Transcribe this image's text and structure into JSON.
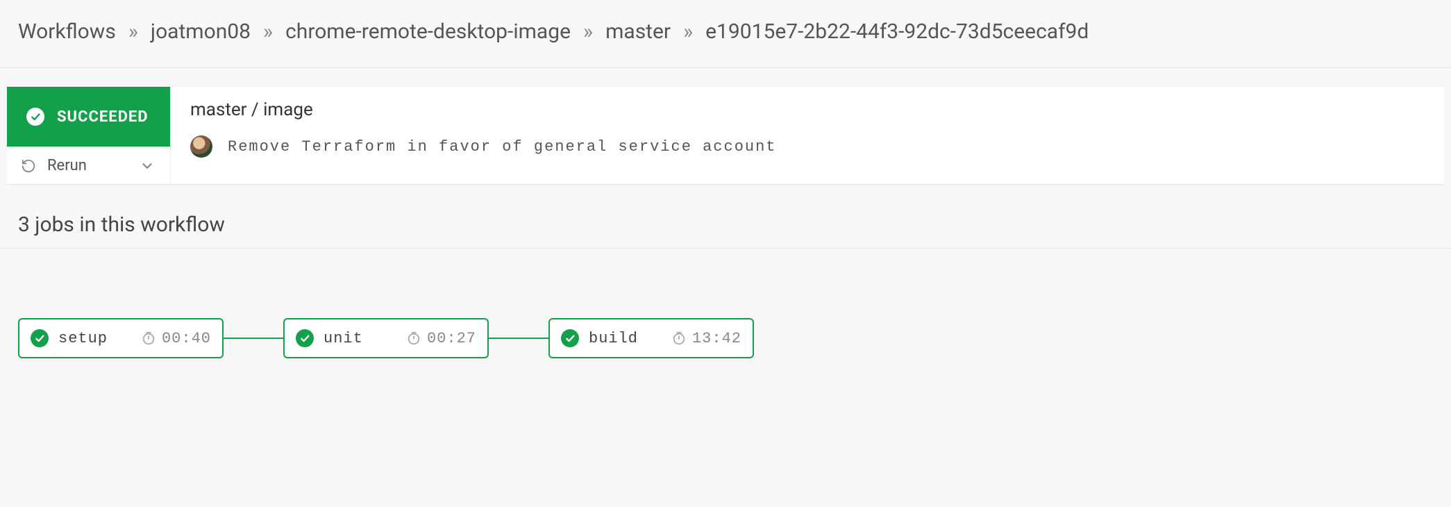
{
  "breadcrumb": {
    "items": [
      "Workflows",
      "joatmon08",
      "chrome-remote-desktop-image",
      "master",
      "e19015e7-2b22-44f3-92dc-73d5ceecaf9d"
    ],
    "separator": "»"
  },
  "status": {
    "label": "SUCCEEDED",
    "rerun_label": "Rerun"
  },
  "workflow": {
    "branch_workflow": "master / image",
    "commit_message": "Remove Terraform in favor of general service account"
  },
  "section": {
    "heading": "3 jobs in this workflow"
  },
  "jobs": [
    {
      "name": "setup",
      "duration": "00:40",
      "status": "success"
    },
    {
      "name": "unit",
      "duration": "00:27",
      "status": "success"
    },
    {
      "name": "build",
      "duration": "13:42",
      "status": "success"
    }
  ],
  "colors": {
    "success": "#12a149",
    "page_bg": "#f7f7f7",
    "text_muted": "#888"
  }
}
